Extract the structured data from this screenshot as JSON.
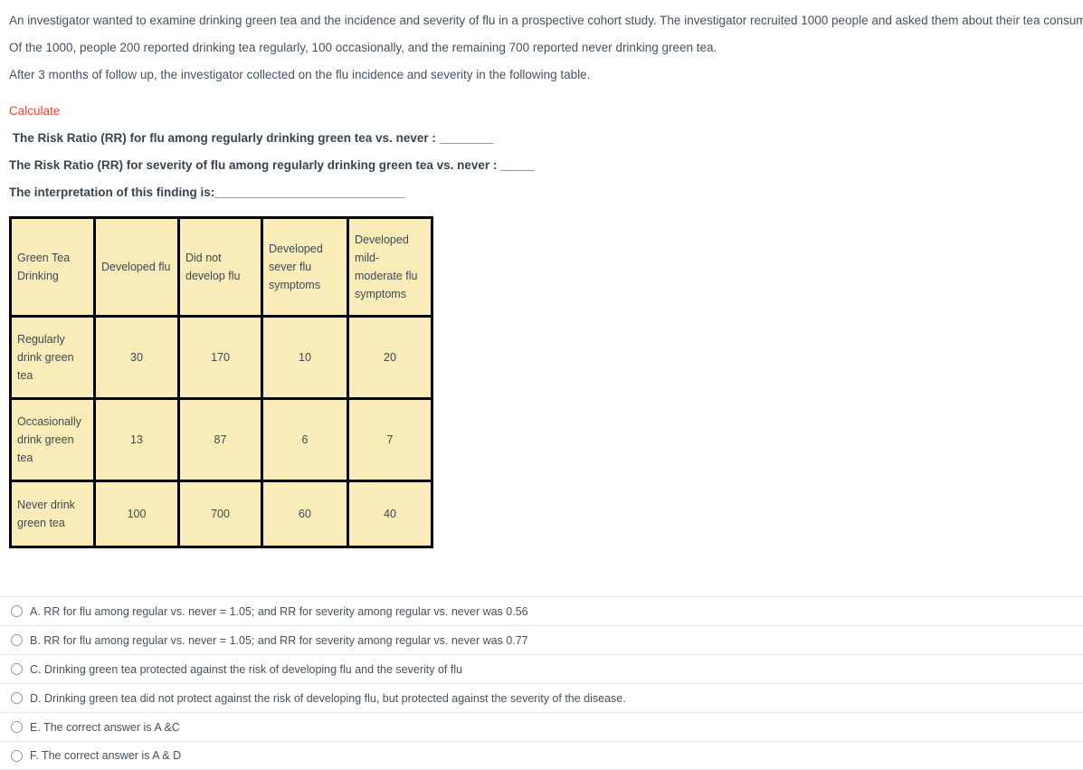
{
  "intro": {
    "paragraphs": [
      "An investigator wanted to examine drinking green tea and the incidence and severity of flu in a prospective cohort study. The investigator recruited 1000 people and asked them about their tea consumption.",
      "Of the 1000, people 200 reported drinking tea regularly, 100 occasionally, and the remaining 700 reported never drinking green tea.",
      "After 3 months of follow up, the investigator collected on the flu incidence and severity in the following table."
    ]
  },
  "calculate": {
    "heading": "Calculate",
    "heading_color": "#e8472f",
    "lines": [
      " The Risk Ratio (RR) for flu among regularly drinking green tea vs. never : ________",
      "The Risk Ratio (RR) for severity of flu among regularly drinking green tea vs. never : _____",
      "The interpretation of this finding is:____________________________"
    ]
  },
  "table": {
    "fill_color": "#f9ecb8",
    "border_color": "#000000",
    "headers": [
      "Green Tea Drinking",
      "Developed flu",
      "Did not develop flu",
      "Developed sever flu symptoms",
      "Developed mild-moderate flu symptoms"
    ],
    "rows": [
      {
        "label": "Regularly drink green tea",
        "developed_flu": "30",
        "did_not_develop_flu": "170",
        "severe_symptoms": "10",
        "mild_moderate_symptoms": "20"
      },
      {
        "label": "Occasionally drink green tea",
        "developed_flu": "13",
        "did_not_develop_flu": "87",
        "severe_symptoms": "6",
        "mild_moderate_symptoms": "7"
      },
      {
        "label": "Never drink green tea",
        "developed_flu": "100",
        "did_not_develop_flu": "700",
        "severe_symptoms": "60",
        "mild_moderate_symptoms": "40"
      }
    ]
  },
  "options": [
    {
      "label": "A. RR for flu among regular vs. never = 1.05; and RR for severity among regular vs. never was 0.56"
    },
    {
      "label": "B. RR for flu among regular vs. never = 1.05; and RR for severity among regular vs. never was 0.77"
    },
    {
      "label": "C. Drinking green tea protected against the risk of developing flu and the severity of flu"
    },
    {
      "label": "D. Drinking green tea did not protect against the risk of developing flu, but protected against the severity of the disease."
    },
    {
      "label": "E. The correct answer is A &C"
    },
    {
      "label": "F. The correct answer is A & D"
    }
  ]
}
